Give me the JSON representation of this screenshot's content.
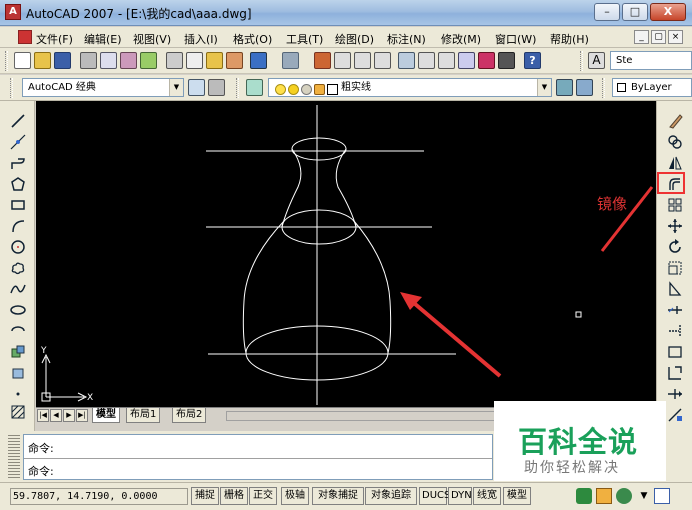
{
  "window": {
    "title": "AutoCAD 2007 - [E:\\我的cad\\aaa.dwg]",
    "minimize_glyph": "–",
    "maximize_glyph": "□",
    "close_glyph": "X"
  },
  "menubar": {
    "items": [
      "文件(F)",
      "编辑(E)",
      "视图(V)",
      "插入(I)",
      "格式(O)",
      "工具(T)",
      "绘图(D)",
      "标注(N)",
      "修改(M)",
      "窗口(W)",
      "帮助(H)"
    ],
    "mdi_buttons": [
      "_",
      "▢",
      "×"
    ]
  },
  "toolbar_standard": {
    "style_truncated": "Ste",
    "icon_names": [
      "new-icon",
      "open-icon",
      "save-icon",
      "print-icon",
      "preview-icon",
      "publish-icon",
      "plot-icon",
      "cut-icon",
      "copy-icon",
      "paste-icon",
      "match-prop-icon",
      "undo-icon",
      "redo-icon",
      "pan-icon",
      "zoom-realtime-icon",
      "zoom-window-icon",
      "zoom-previous-icon",
      "properties-icon",
      "design-center-icon",
      "tool-palettes-icon",
      "sheet-set-icon",
      "markup-icon",
      "calculator-icon",
      "help-icon",
      "text-style-icon"
    ]
  },
  "toolbar_workspace": {
    "workspace_value": "AutoCAD 经典",
    "layer_value": "粗实线",
    "bylayer_label": "ByLayer"
  },
  "canvas": {
    "background": "#000000",
    "line_color": "#ffffff",
    "ucs_x": "X",
    "ucs_y": "Y"
  },
  "layout_tabs": [
    "模型",
    "布局1",
    "布局2"
  ],
  "command": {
    "line1": "命令:",
    "line2": "命令:"
  },
  "watermark": {
    "title": "百科全说",
    "subtitle": "助你轻松解决",
    "color": "#1aa05a"
  },
  "status": {
    "coordinates": "59.7807, 14.7190, 0.0000",
    "buttons": [
      "捕捉",
      "栅格",
      "正交",
      "极轴",
      "对象捕捉",
      "对象追踪",
      "DUCS",
      "DYN",
      "线宽",
      "模型"
    ]
  },
  "annotation": {
    "label": "镜像",
    "color": "#dd3333"
  },
  "left_toolbar_icons": [
    "line-icon",
    "construction-line-icon",
    "polyline-icon",
    "polygon-icon",
    "rectangle-icon",
    "arc-icon",
    "circle-icon",
    "revision-cloud-icon",
    "spline-icon",
    "ellipse-icon",
    "ellipse-arc-icon",
    "insert-block-icon",
    "make-block-icon",
    "point-icon",
    "hatch-icon"
  ],
  "right_toolbar_icons": [
    "erase-icon",
    "copy-object-icon",
    "mirror-icon",
    "offset-icon",
    "array-icon",
    "move-icon",
    "rotate-icon",
    "scale-icon",
    "stretch-icon",
    "trim-icon",
    "extend-icon",
    "break-icon",
    "join-icon",
    "chamfer-icon",
    "explode-icon"
  ]
}
